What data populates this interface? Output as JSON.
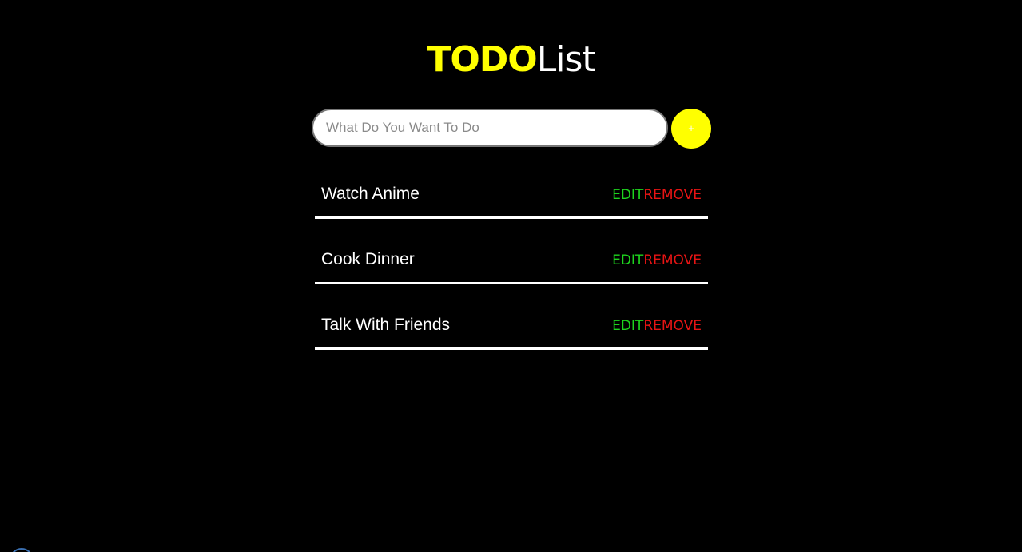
{
  "header": {
    "title_accent": "TODO",
    "title_rest": "List",
    "accent_color": "#ffff00"
  },
  "input": {
    "placeholder": "What Do You Want To Do",
    "value": ""
  },
  "add_button": {
    "label": "+",
    "color": "#ffff00"
  },
  "todos": [
    {
      "text": "Watch Anime",
      "edit_label": "EDIT",
      "remove_label": "REMOVE"
    },
    {
      "text": "Cook Dinner",
      "edit_label": "EDIT",
      "remove_label": "REMOVE"
    },
    {
      "text": "Talk With Friends",
      "edit_label": "EDIT",
      "remove_label": "REMOVE"
    }
  ],
  "colors": {
    "background": "#000000",
    "edit": "#1ed31e",
    "remove": "#e81414",
    "divider": "#ffffff"
  }
}
